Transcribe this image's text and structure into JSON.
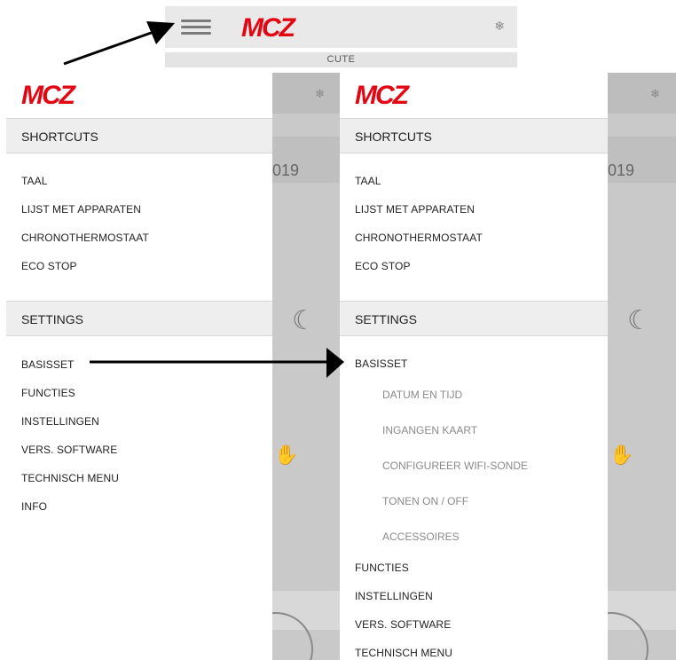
{
  "brand": {
    "logo_text": "MCZ",
    "logo_color": "#e30613"
  },
  "topbar": {
    "menu_icon": "hamburger-icon",
    "status_icon": "snowflake-icon",
    "subtitle": "CUTE"
  },
  "background_app": {
    "year_fragment": "019",
    "status_icon": "snowflake-icon",
    "mode_icon": "moon-icon",
    "stop_icon": "hand-icon"
  },
  "drawer_left": {
    "shortcuts_title": "SHORTCUTS",
    "shortcuts": [
      "TAAL",
      "LIJST MET APPARATEN",
      "CHRONOTHERMOSTAAT",
      "ECO STOP"
    ],
    "settings_title": "SETTINGS",
    "settings": [
      "BASISSET",
      "FUNCTIES",
      "INSTELLINGEN",
      "VERS. SOFTWARE",
      "TECHNISCH MENU",
      "INFO"
    ]
  },
  "drawer_right": {
    "shortcuts_title": "SHORTCUTS",
    "shortcuts": [
      "TAAL",
      "LIJST MET APPARATEN",
      "CHRONOTHERMOSTAAT",
      "ECO STOP"
    ],
    "settings_title": "SETTINGS",
    "expanded_item": "BASISSET",
    "submenu": [
      "DATUM EN TIJD",
      "INGANGEN KAART",
      "CONFIGUREER WIFI-SONDE",
      "TONEN ON / OFF",
      "ACCESSOIRES"
    ],
    "settings_rest": [
      "FUNCTIES",
      "INSTELLINGEN",
      "VERS. SOFTWARE",
      "TECHNISCH MENU"
    ]
  }
}
